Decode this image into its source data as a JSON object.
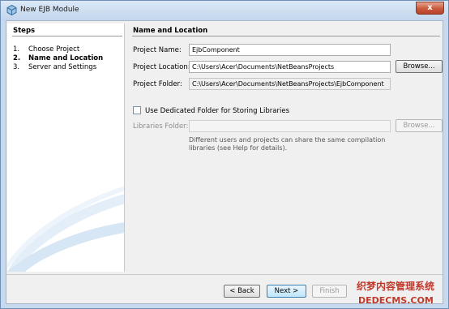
{
  "window": {
    "title": "New EJB Module",
    "close_glyph": "x"
  },
  "steps": {
    "header": "Steps",
    "items": [
      {
        "num": "1.",
        "label": "Choose Project",
        "current": false
      },
      {
        "num": "2.",
        "label": "Name and Location",
        "current": true
      },
      {
        "num": "3.",
        "label": "Server and Settings",
        "current": false
      }
    ]
  },
  "main": {
    "header": "Name and Location",
    "project_name": {
      "label": "Project Name:",
      "value": "EjbComponent"
    },
    "project_location": {
      "label": "Project Location:",
      "value": "C:\\Users\\Acer\\Documents\\NetBeansProjects",
      "browse_label": "Browse..."
    },
    "project_folder": {
      "label": "Project Folder:",
      "value": "C:\\Users\\Acer\\Documents\\NetBeansProjects\\EjbComponent"
    },
    "dedicated_folder": {
      "label": "Use Dedicated Folder for Storing Libraries",
      "checked": false
    },
    "libraries_folder": {
      "label": "Libraries Folder:",
      "value": "",
      "browse_label": "Browse..."
    },
    "note": "Different users and projects can share the same compilation libraries (see Help for details)."
  },
  "footer": {
    "back_label": "< Back",
    "next_label": "Next >",
    "finish_label": "Finish"
  },
  "watermark": {
    "line1": "织梦内容管理系统",
    "line2": "DEDECMS.COM"
  },
  "colors": {
    "title_bar": "#c6d9ee",
    "close_button": "#c85a3c",
    "dialog_bg": "#f0f0f0"
  },
  "icons": {
    "app": "netbeans-cube-icon",
    "checkbox": "checkbox-unchecked-icon"
  }
}
